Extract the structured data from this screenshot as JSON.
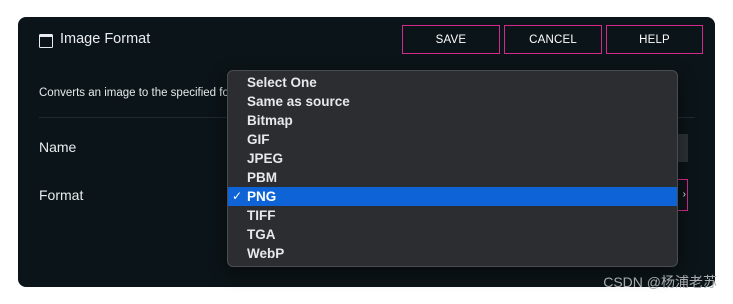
{
  "dialog": {
    "title": "Image Format",
    "description": "Converts an image to the specified format",
    "buttons": {
      "save": "SAVE",
      "cancel": "CANCEL",
      "help": "HELP"
    }
  },
  "fields": {
    "name_label": "Name",
    "format_label": "Format",
    "format_selected": "PNG"
  },
  "format_options": [
    {
      "label": "Select One",
      "selected": false
    },
    {
      "label": "Same as source",
      "selected": false
    },
    {
      "label": "Bitmap",
      "selected": false
    },
    {
      "label": "GIF",
      "selected": false
    },
    {
      "label": "JPEG",
      "selected": false
    },
    {
      "label": "PBM",
      "selected": false
    },
    {
      "label": "PNG",
      "selected": true
    },
    {
      "label": "TIFF",
      "selected": false
    },
    {
      "label": "TGA",
      "selected": false
    },
    {
      "label": "WebP",
      "selected": false
    }
  ],
  "check_glyph": "✓",
  "watermark": "CSDN @杨浦老苏",
  "colors": {
    "background": "#0b1418",
    "button_border": "#d22a8c",
    "menu_background": "#2b2d31",
    "selection": "#0e63d6"
  }
}
